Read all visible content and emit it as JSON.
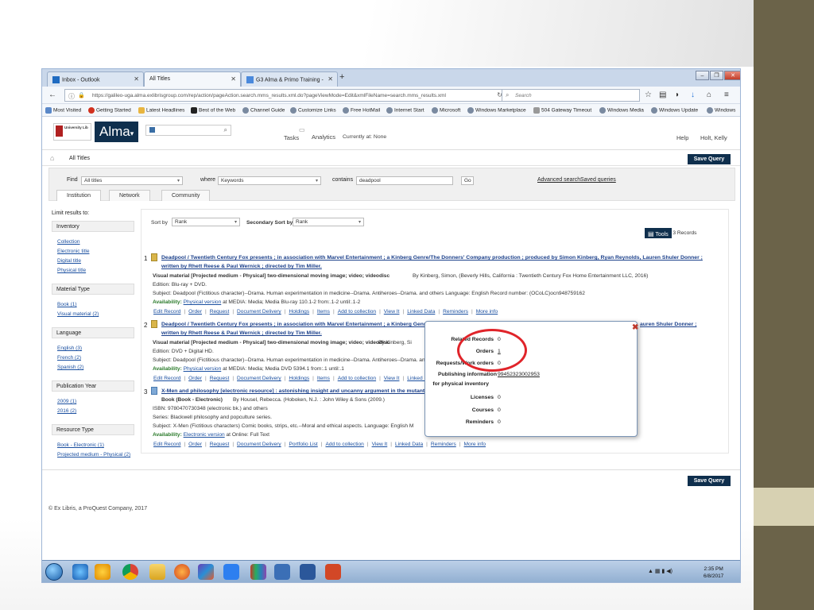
{
  "browser": {
    "tabs": [
      {
        "label": "Inbox - Outlook",
        "icon": "outlook-icon"
      },
      {
        "label": "All Titles",
        "icon": "page-icon"
      },
      {
        "label": "G3 Alma & Primo Training - ",
        "icon": "google-docs-icon"
      }
    ],
    "url": "https://galileo-uga.alma.exlibrisgroup.com/rep/action/pageAction.search.mms_results.xml.do?pageViewMode=Edit&xmlFileName=search.mms_results.xml",
    "search_placeholder": "Search",
    "bookmarks": [
      "Most Visited",
      "Getting Started",
      "Latest Headlines",
      "Best of the Web",
      "Channel Guide",
      "Customize Links",
      "Free HotMail",
      "Internet Start",
      "Microsoft",
      "Windows Marketplace",
      "504 Gateway Timeout",
      "Windows Media",
      "Windows Update",
      "Windows"
    ]
  },
  "alma_header": {
    "logo_text": "Alma",
    "uni_name": "University Lib",
    "tasks": "Tasks",
    "analytics": "Analytics",
    "currently_at": "Currently at: None",
    "help": "Help",
    "user": "Holt, Kelly"
  },
  "page": {
    "title": "All Titles",
    "save_query": "Save Query"
  },
  "search_panel": {
    "find_label": "Find",
    "find_value": "All titles",
    "where_label": "where",
    "where_value": "Keywords",
    "contains_label": "contains",
    "contains_value": "deadpool",
    "go": "Go",
    "advanced": "Advanced search",
    "saved": "Saved queries",
    "tabs": [
      "Institution",
      "Network",
      "Community"
    ]
  },
  "facets": {
    "limit_label": "Limit results to:",
    "groups": [
      {
        "head": "Inventory",
        "items": [
          "Collection",
          "Electronic title",
          "Digital title",
          "Physical title"
        ]
      },
      {
        "head": "Material Type",
        "items": [
          "Book (1)",
          "Visual material (2)"
        ]
      },
      {
        "head": "Language",
        "items": [
          "English (3)",
          "French (2)",
          "Spanish (2)"
        ]
      },
      {
        "head": "Publication Year",
        "items": [
          "2009 (1)",
          "2016 (2)"
        ]
      },
      {
        "head": "Resource Type",
        "items": [
          "Book - Electronic (1)",
          "Projected medium - Physical (2)"
        ]
      }
    ]
  },
  "results_bar": {
    "sort_label": "Sort by",
    "sort_value": "Rank",
    "secondary_label": "Secondary Sort by",
    "secondary_value": "Rank",
    "count": "1 - 3 of 3 Records",
    "tools": "Tools"
  },
  "results": [
    {
      "num": "1",
      "title1": "Deadpool / Twentieth Century Fox presents ; in association with Marvel Entertainment ; a Kinberg Genre/The Donners' Company production ; produced by Simon Kinberg, Ryan Reynolds, Lauren Shuler Donner ;",
      "title2": "written by Rhett Reese & Paul Wernick ; directed by Tim Miller.",
      "type_line": "Visual material [Projected medium - Physical] two-dimensional moving image; video; videodisc",
      "type_rest": "By Kinberg, Simon, (Beverly Hills, California : Twentieth Century Fox Home Entertainment LLC, 2016)",
      "edition": "Edition: Blu-ray + DVD.",
      "subject": "Subject: Deadpool (Fictitious character)--Drama. Human experimentation in medicine--Drama. Antiheroes--Drama. and others    Language: English    Record number: (OCoLC)ocn948759162",
      "availability_label": "Availability:",
      "availability_link": "Physical version",
      "availability_rest": "at MEDIA: Media; Media Blu-ray 110.1-2 from:.1-2 until:.1-2",
      "actions": [
        "Edit Record",
        "Order",
        "Request",
        "Document Delivery",
        "Holdings",
        "Items",
        "Add to collection",
        "View It",
        "Linked Data",
        "Reminders",
        "More info"
      ]
    },
    {
      "num": "2",
      "title1": "Deadpool / Twentieth Century Fox presents ; in association with Marvel Entertainment ; a Kinberg Genr",
      "title1b": "auren Shuler Donner ;",
      "title2": "written by Rhett Reese & Paul Wernick ; directed by Tim Miller.",
      "type_line": "Visual material [Projected medium - Physical] two-dimensional moving image; video; videodisc",
      "type_rest": "By Kinberg, Si",
      "edition": "Edition: DVD + Digital HD.",
      "subject": "Subject: Deadpool (Fictitious character)--Drama. Human experimentation in medicine--Drama. Antiheroes--Drama. an",
      "availability_label": "Availability:",
      "availability_link": "Physical version",
      "availability_rest": "at MEDIA: Media; Media DVD 5394.1 from:.1 until:.1",
      "actions": [
        "Edit Record",
        "Order",
        "Request",
        "Document Delivery",
        "Holdings",
        "Items",
        "Add to collection",
        "View It",
        "Linked Data",
        "Re"
      ]
    },
    {
      "num": "3",
      "title1": "X-Men and philosophy [electronic resource] : astonishing insight and uncanny argument in the mutant X",
      "type_line": "Book (Book - Electronic)",
      "type_rest": "By Housel, Rebecca. (Hoboken, N.J. : John Wiley & Sons (2009.)",
      "isbn": "ISBN: 9780470730348 (electronic bk.) and others",
      "series": "Series: Blackwell philosophy and popculture series.",
      "subject": "Subject: X-Men (Fictitious characters) Comic books, strips, etc.--Moral and ethical aspects.    Language: English    M",
      "availability_label": "Availability:",
      "availability_link": "Electronic version",
      "availability_rest": "at Online: Full Text",
      "actions": [
        "Edit Record",
        "Order",
        "Request",
        "Document Delivery",
        "Portfolio List",
        "Add to collection",
        "View It",
        "Linked Data",
        "Reminders",
        "More info"
      ]
    }
  ],
  "popup": {
    "rows": [
      {
        "label": "Related Records",
        "value": "0"
      },
      {
        "label": "Orders",
        "value": "1"
      },
      {
        "label": "Requests/Work orders",
        "value": "0"
      },
      {
        "label": "Publishing information",
        "value": "99452323002953"
      },
      {
        "label": "for physical inventory",
        "value": ""
      },
      {
        "label": "Licenses",
        "value": "0"
      },
      {
        "label": "Courses",
        "value": "0"
      },
      {
        "label": "Reminders",
        "value": "0"
      }
    ]
  },
  "footer": {
    "copyright": "© Ex Libris, a ProQuest Company, 2017"
  },
  "taskbar": {
    "time": "2:35 PM",
    "date": "6/8/2017"
  },
  "colors": {
    "alma_navy": "#0f2f4d",
    "link_blue": "#1a4fa0",
    "highlight_red": "#e0242a",
    "slide_olive": "#6b6349"
  }
}
